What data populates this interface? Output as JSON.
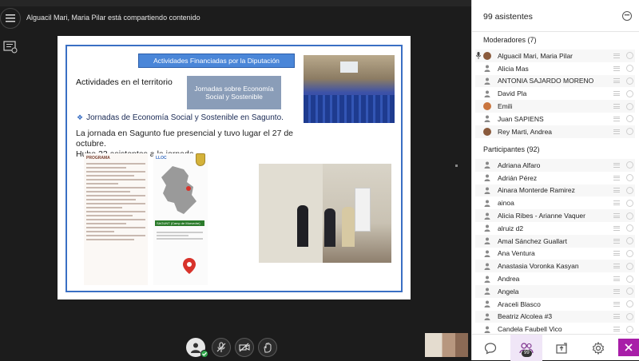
{
  "header": {
    "share_title": "Alguacil Mari, Maria Pilar está compartiendo contenido"
  },
  "slide": {
    "banner": "Actividades Financiadas por la Diputación",
    "sub_heading": "Actividades en el territorio",
    "gray_box": "Jornadas sobre Economía Social y Sostenible",
    "bullet": "Jornadas de Economía Social y Sostenible en Sagunto.",
    "para_line1": "La jornada en Sagunto fue presencial y tuvo lugar el 27 de octubre.",
    "para_line2": "Hubo 23 asistentes a la jornada.",
    "program_heading": "PROGRAMA",
    "map_heading": "LLOC",
    "map_tag": "SAGUNT (Camp de Morvedre)"
  },
  "panel": {
    "title": "99 asistentes",
    "moderators_label": "Moderadores (7)",
    "moderators": [
      {
        "name": "Alguacil Mari, Maria Pilar",
        "avatar": "photo-brown",
        "mic": true
      },
      {
        "name": "Alicia Mas",
        "avatar": "person-icon",
        "mic": false
      },
      {
        "name": "ANTONIA SAJARDO MORENO",
        "avatar": "person-icon",
        "mic": false
      },
      {
        "name": "David Pla",
        "avatar": "person-icon",
        "mic": false
      },
      {
        "name": "Emili",
        "avatar": "photo-orange",
        "mic": false
      },
      {
        "name": "Juan SAPIENS",
        "avatar": "person-icon",
        "mic": false
      },
      {
        "name": "Rey Marti, Andrea",
        "avatar": "photo-brown",
        "mic": false
      }
    ],
    "participants_label": "Participantes (92)",
    "participants": [
      "Adriana Alfaro",
      "Adrián Pérez",
      "Ainara Monterde Ramirez",
      "ainoa",
      "Alicia Ribes - Arianne Vaquer",
      "alruiz d2",
      "Amal Sánchez Guallart",
      "Ana Ventura",
      "Anastasia Voronka Kasyan",
      "Andrea",
      "Angela",
      "Araceli Blasco",
      "Beatriz Alcolea #3",
      "Candela Faubell Vico"
    ],
    "badge": "99"
  },
  "colors": {
    "accent": "#a81ea8",
    "banner": "#4a86d8",
    "status_green": "#2ea84a"
  }
}
